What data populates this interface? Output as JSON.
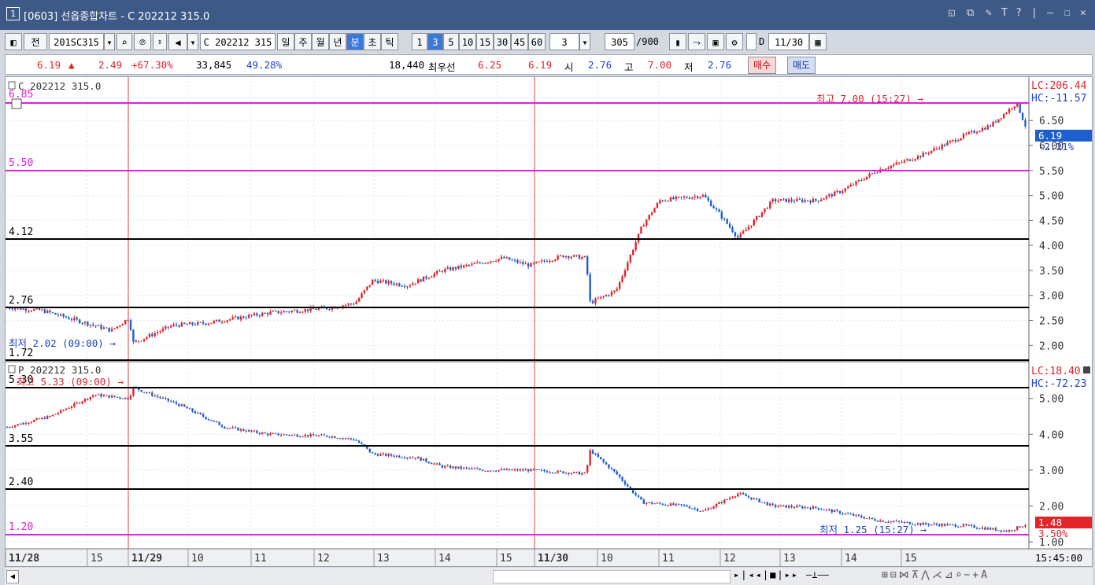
{
  "titlebar": {
    "window_num": "1",
    "title": "[0603] 선옵종합차트 - C 202212 315.0",
    "icons": [
      "restore-icon",
      "copy-icon",
      "clear-icon",
      "font-icon",
      "help-icon",
      "minimize-icon",
      "maximize-icon",
      "close-icon"
    ]
  },
  "toolbar": {
    "prev": "전",
    "code": "201SC315",
    "name": "C 202212 315",
    "periods": [
      "일",
      "주",
      "월",
      "년",
      "분",
      "초",
      "틱"
    ],
    "active_period": "분",
    "minutes": [
      "1",
      "3",
      "5",
      "10",
      "15",
      "30",
      "45",
      "60"
    ],
    "active_minute": "3",
    "interval": "3",
    "count": "305",
    "count_max": "/900",
    "date": "11/30",
    "date_check": "D"
  },
  "quote": {
    "price": "6.19",
    "arrow": "▲",
    "change": "2.49",
    "change_pct": "+67.30%",
    "volume": "33,845",
    "vol_pct": "49.28%",
    "open_int": "18,440",
    "best_label": "최우선",
    "ask": "6.25",
    "bid": "6.19",
    "open_label": "시",
    "open": "2.76",
    "high_label": "고",
    "high": "7.00",
    "low_label": "저",
    "low": "2.76",
    "buy": "매수",
    "sell": "매도"
  },
  "top_panel": {
    "title": "C 202212 315.0",
    "level_labels": [
      "6.85",
      "5.50",
      "4.12",
      "2.76",
      "1.72"
    ],
    "lc": "LC:206.44",
    "hc": "HC:-11.57",
    "price_tag": "6.19",
    "pct_tag": "-2.21%",
    "ticks": [
      "6.50",
      "6.00",
      "5.50",
      "5.00",
      "4.50",
      "4.00",
      "3.50",
      "3.00",
      "2.50",
      "2.00"
    ],
    "high_annot": "최고 7.00 (15:27) →",
    "low_annot": "최저 2.02 (09:00) →"
  },
  "bottom_panel": {
    "title": "P 202212 315.0",
    "level_labels": [
      "5.30",
      "3.55",
      "2.40",
      "1.20"
    ],
    "lc": "LC:18.40",
    "hc": "HC:-72.23",
    "price_tag": "1.48",
    "pct_tag": "3.50%",
    "ticks": [
      "5.00",
      "4.00",
      "3.00",
      "2.00",
      "1.00"
    ],
    "high_annot": "최고 5.33 (09:00) →",
    "low_annot": "최저 1.25 (15:27) →"
  },
  "time_axis": {
    "labels": [
      "11/28",
      "15",
      "11/29",
      "10",
      "11",
      "12",
      "13",
      "14",
      "15",
      "11/30",
      "10",
      "11",
      "12",
      "13",
      "14",
      "15"
    ],
    "current": "15:45:00"
  },
  "colors": {
    "up": "#e0252b",
    "down": "#1d5fd1",
    "support": "#000000",
    "magenta": "#e020e0",
    "vline": "#d04040"
  },
  "chart_data": [
    {
      "type": "candlestick",
      "title": "C 202212 315.0",
      "y_range": [
        1.72,
        6.85
      ],
      "close_path": [
        [
          0,
          2.76
        ],
        [
          0.04,
          2.7
        ],
        [
          0.08,
          2.5
        ],
        [
          0.12,
          2.3
        ],
        [
          0.14,
          2.55
        ],
        [
          0.145,
          2.05
        ],
        [
          0.19,
          2.4
        ],
        [
          0.23,
          2.45
        ],
        [
          0.3,
          2.65
        ],
        [
          0.37,
          2.75
        ],
        [
          0.4,
          2.85
        ],
        [
          0.42,
          3.3
        ],
        [
          0.46,
          3.2
        ],
        [
          0.5,
          3.5
        ],
        [
          0.53,
          3.6
        ],
        [
          0.57,
          3.75
        ],
        [
          0.6,
          3.6
        ],
        [
          0.64,
          3.8
        ],
        [
          0.665,
          3.75
        ],
        [
          0.67,
          2.85
        ],
        [
          0.7,
          3.1
        ],
        [
          0.73,
          4.4
        ],
        [
          0.75,
          4.9
        ],
        [
          0.8,
          5.0
        ],
        [
          0.82,
          4.6
        ],
        [
          0.84,
          4.15
        ],
        [
          0.88,
          4.9
        ],
        [
          0.93,
          4.9
        ],
        [
          0.96,
          5.1
        ],
        [
          1.0,
          5.5
        ],
        [
          1.05,
          5.8
        ],
        [
          1.1,
          6.2
        ],
        [
          1.13,
          6.4
        ],
        [
          1.16,
          6.85
        ],
        [
          1.17,
          6.4
        ]
      ]
    },
    {
      "type": "candlestick",
      "title": "P 202212 315.0",
      "y_range": [
        1.2,
        5.3
      ],
      "close_path": [
        [
          0,
          4.2
        ],
        [
          0.05,
          4.5
        ],
        [
          0.1,
          5.1
        ],
        [
          0.14,
          5.0
        ],
        [
          0.145,
          5.3
        ],
        [
          0.2,
          4.8
        ],
        [
          0.25,
          4.2
        ],
        [
          0.3,
          4.0
        ],
        [
          0.37,
          3.95
        ],
        [
          0.4,
          3.85
        ],
        [
          0.42,
          3.45
        ],
        [
          0.47,
          3.35
        ],
        [
          0.5,
          3.1
        ],
        [
          0.55,
          3.0
        ],
        [
          0.6,
          3.0
        ],
        [
          0.665,
          2.9
        ],
        [
          0.67,
          3.55
        ],
        [
          0.7,
          2.9
        ],
        [
          0.73,
          2.1
        ],
        [
          0.78,
          2.0
        ],
        [
          0.8,
          1.85
        ],
        [
          0.84,
          2.35
        ],
        [
          0.88,
          2.0
        ],
        [
          0.93,
          1.95
        ],
        [
          1.0,
          1.6
        ],
        [
          1.05,
          1.5
        ],
        [
          1.1,
          1.45
        ],
        [
          1.15,
          1.3
        ],
        [
          1.17,
          1.48
        ]
      ]
    }
  ]
}
